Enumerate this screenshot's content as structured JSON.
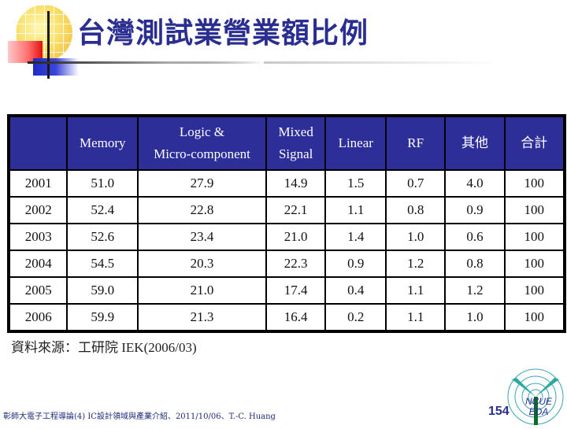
{
  "slide": {
    "title": "台灣測試業營業額比例",
    "table": {
      "headers": [
        "",
        "Memory",
        "Logic &\nMicro-component",
        "Mixed\nSignal",
        "Linear",
        "RF",
        "其他",
        "合計"
      ],
      "header_lines": [
        [
          ""
        ],
        [
          "Memory"
        ],
        [
          "Logic &",
          "Micro-component"
        ],
        [
          "Mixed",
          "Signal"
        ],
        [
          "Linear"
        ],
        [
          "RF"
        ],
        [
          "其他"
        ],
        [
          "合計"
        ]
      ],
      "rows": [
        [
          "2001",
          "51.0",
          "27.9",
          "14.9",
          "1.5",
          "0.7",
          "4.0",
          "100"
        ],
        [
          "2002",
          "52.4",
          "22.8",
          "22.1",
          "1.1",
          "0.8",
          "0.9",
          "100"
        ],
        [
          "2003",
          "52.6",
          "23.4",
          "21.0",
          "1.4",
          "1.0",
          "0.6",
          "100"
        ],
        [
          "2004",
          "54.5",
          "20.3",
          "22.3",
          "0.9",
          "1.2",
          "0.8",
          "100"
        ],
        [
          "2005",
          "59.0",
          "21.0",
          "17.4",
          "0.4",
          "1.1",
          "1.2",
          "100"
        ],
        [
          "2006",
          "59.9",
          "21.3",
          "16.4",
          "0.2",
          "1.1",
          "1.0",
          "100"
        ]
      ]
    },
    "source": "資料來源：工研院 IEK(2006/03)",
    "footer": "彰師大電子工程導論(4) IC設計領域與產業介紹、2011/10/06、T.-C. Huang",
    "page_number": "154",
    "org_logo": {
      "line1": "NCUE",
      "line2": "EDA"
    },
    "colors": {
      "title": "#2b2e91",
      "header_bg": "#2e2e98",
      "header_text": "#ffffff",
      "footer_text": "#1f2a7a"
    }
  }
}
